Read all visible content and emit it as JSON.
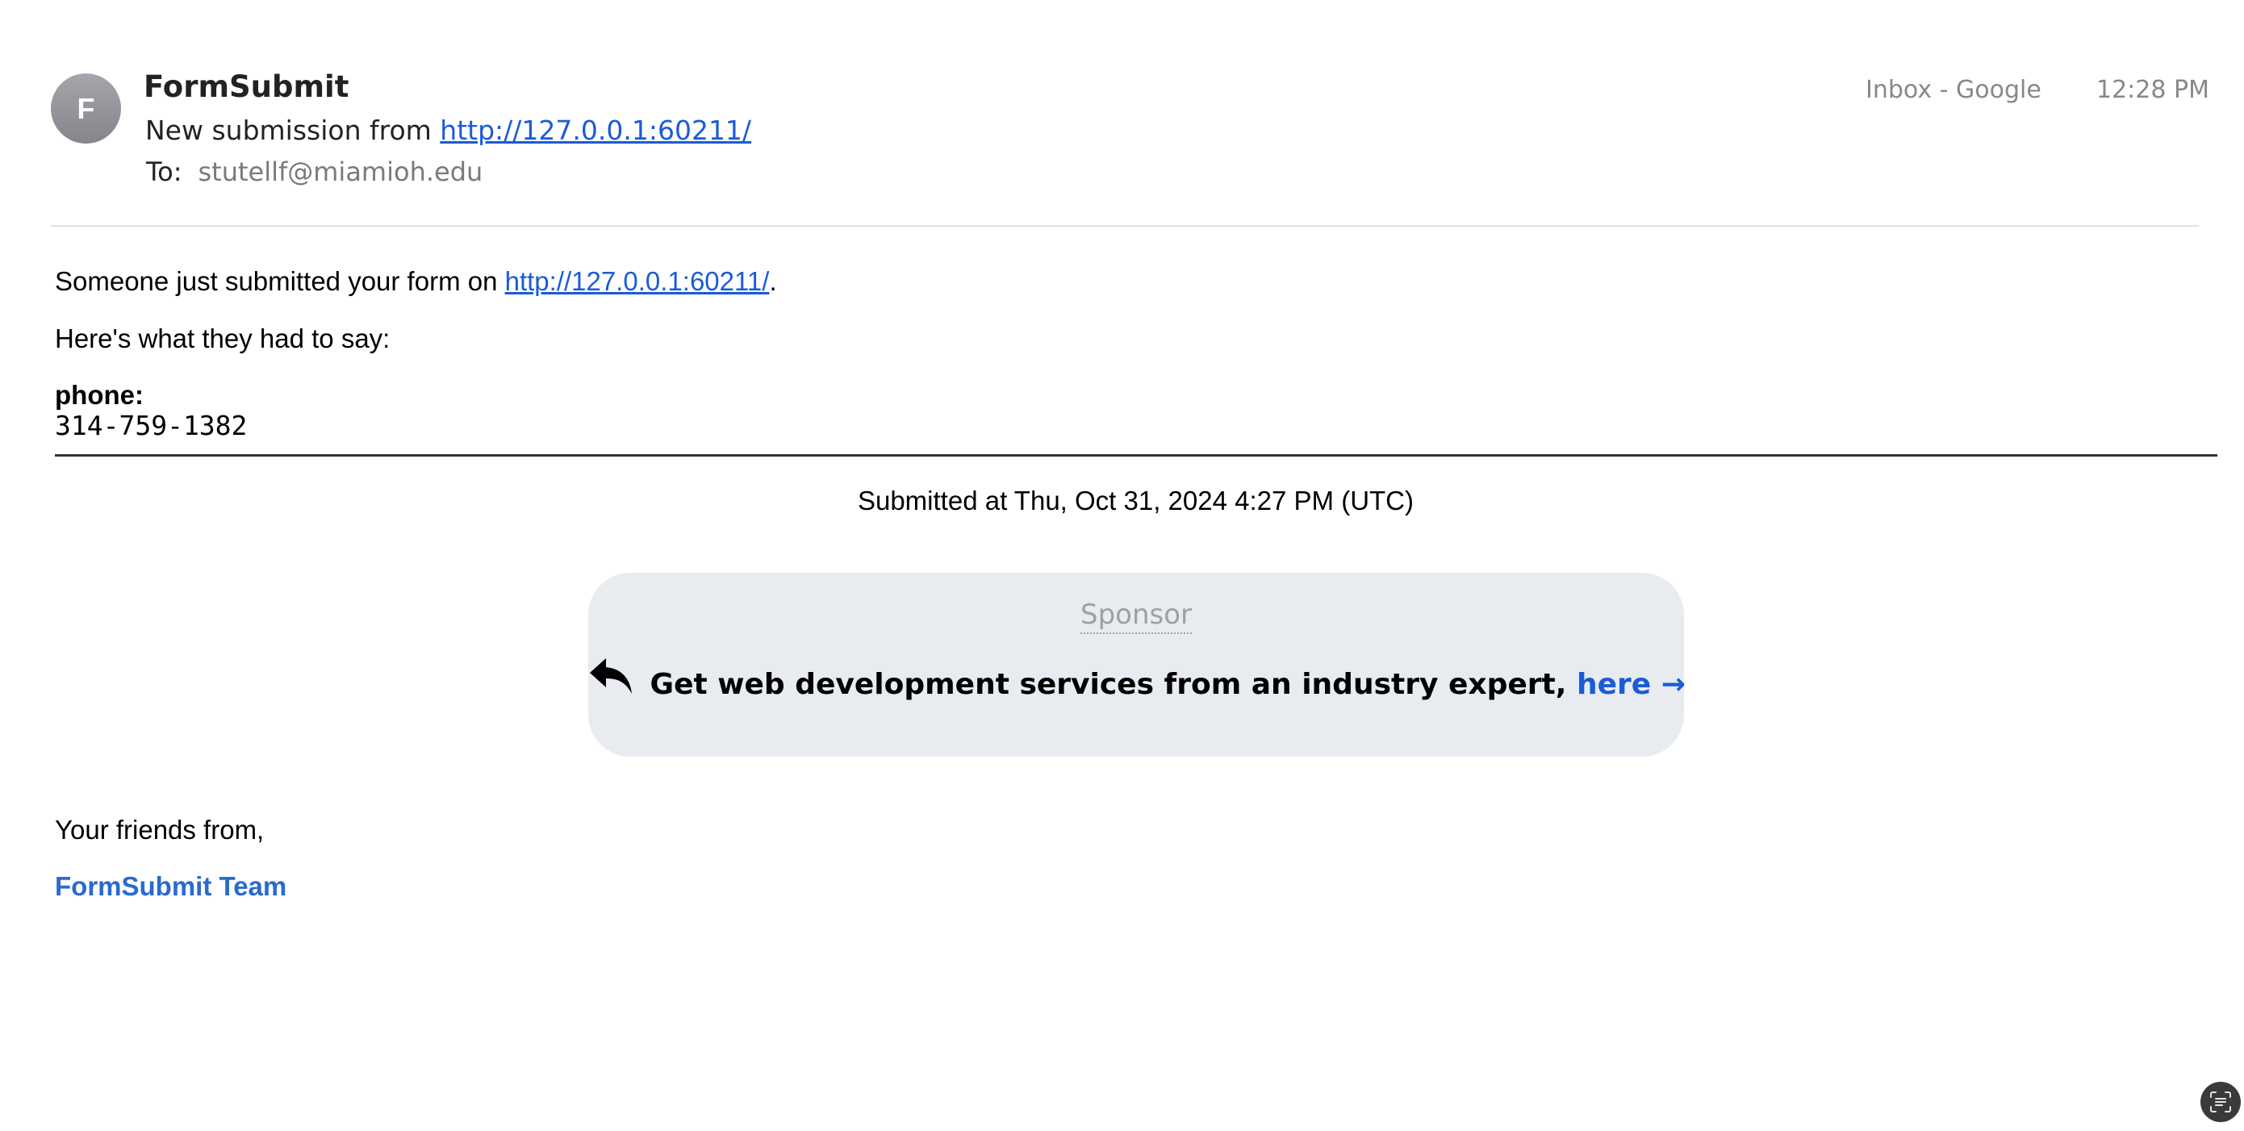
{
  "header": {
    "avatar_initial": "F",
    "sender": "FormSubmit",
    "subject_prefix": "New submission from",
    "subject_link": "http://127.0.0.1:60211/",
    "to_label": "To:",
    "to_address": "stutellf@miamioh.edu",
    "mailbox": "Inbox - Google",
    "time": "12:28 PM",
    "folder_icon": "folder-icon"
  },
  "body": {
    "intro_prefix": "Someone just submitted your form on",
    "intro_link": "http://127.0.0.1:60211/",
    "intro_suffix": ".",
    "say": "Here's what they had to say:",
    "field_label": "phone:",
    "field_value": "314-759-1382",
    "submitted": "Submitted at Thu, Oct 31, 2024 4:27 PM (UTC)"
  },
  "sponsor": {
    "label": "Sponsor",
    "text": "Get web development services from an industry expert,",
    "link": "here →",
    "icon": "reply-arrow-icon"
  },
  "signoff": {
    "friends": "Your friends from,",
    "team": "FormSubmit Team"
  },
  "colors": {
    "link": "#1a5bd8",
    "sponsor_bg": "#e8ebf0",
    "muted": "#888888"
  }
}
